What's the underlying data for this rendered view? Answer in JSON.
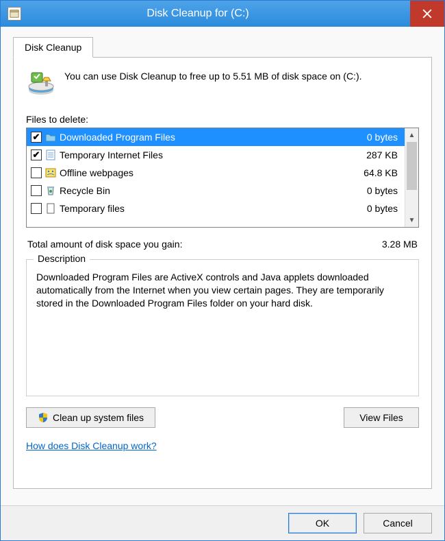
{
  "window": {
    "title": "Disk Cleanup for  (C:)"
  },
  "tab": {
    "label": "Disk Cleanup"
  },
  "intro": "You can use Disk Cleanup to free up to 5.51 MB of disk space on  (C:).",
  "files_to_delete_label": "Files to delete:",
  "file_items": [
    {
      "checked": true,
      "name": "Downloaded Program Files",
      "size": "0 bytes",
      "icon": "folder",
      "selected": true
    },
    {
      "checked": true,
      "name": "Temporary Internet Files",
      "size": "287 KB",
      "icon": "doc",
      "selected": false
    },
    {
      "checked": false,
      "name": "Offline webpages",
      "size": "64.8 KB",
      "icon": "web",
      "selected": false
    },
    {
      "checked": false,
      "name": "Recycle Bin",
      "size": "0 bytes",
      "icon": "bin",
      "selected": false
    },
    {
      "checked": false,
      "name": "Temporary files",
      "size": "0 bytes",
      "icon": "file",
      "selected": false
    }
  ],
  "total_label": "Total amount of disk space you gain:",
  "total_value": "3.28 MB",
  "description": {
    "legend": "Description",
    "text": "Downloaded Program Files are ActiveX controls and Java applets downloaded automatically from the Internet when you view certain pages. They are temporarily stored in the Downloaded Program Files folder on your hard disk."
  },
  "buttons": {
    "cleanup_system": "Clean up system files",
    "view_files": "View Files",
    "ok": "OK",
    "cancel": "Cancel"
  },
  "help_link": "How does Disk Cleanup work?"
}
